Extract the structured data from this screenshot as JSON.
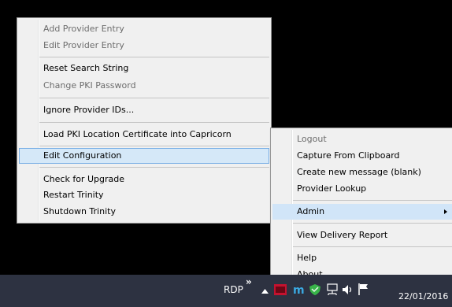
{
  "menu_left": {
    "items": [
      {
        "label": "Add Provider Entry",
        "disabled": true
      },
      {
        "label": "Edit Provider Entry",
        "disabled": true
      },
      {
        "label": "Reset Search String",
        "disabled": false
      },
      {
        "label": "Change PKI Password",
        "disabled": true
      },
      {
        "label": "Ignore Provider IDs...",
        "disabled": false
      },
      {
        "label": "Load PKI Location Certificate into Capricorn",
        "disabled": false
      },
      {
        "label": "Edit Configuration",
        "disabled": false,
        "highlighted": true
      },
      {
        "label": "Check for Upgrade",
        "disabled": false
      },
      {
        "label": "Restart Trinity",
        "disabled": false
      },
      {
        "label": "Shutdown Trinity",
        "disabled": false
      }
    ]
  },
  "menu_right": {
    "items": [
      {
        "label": "Logout",
        "disabled": true
      },
      {
        "label": "Capture From Clipboard",
        "disabled": false
      },
      {
        "label": "Create new message (blank)",
        "disabled": false
      },
      {
        "label": "Provider Lookup",
        "disabled": false
      },
      {
        "label": "Admin",
        "disabled": false,
        "has_submenu": true,
        "hovered": true
      },
      {
        "label": "View Delivery Report",
        "disabled": false
      },
      {
        "label": "Help",
        "disabled": false
      },
      {
        "label": "About...",
        "disabled": false
      }
    ]
  },
  "taskbar": {
    "toolbar_label": "RDP",
    "overflow_chevron": "»",
    "date": "22/01/2016",
    "colors": {
      "background": "#2d3241",
      "menu_background": "#f0f0f0",
      "highlight": "#d5e8f8",
      "highlight_border": "#78aee5"
    }
  },
  "tray_icons": [
    "show-hidden-icons-arrow-icon",
    "hl7-icon",
    "m-app-icon",
    "green-shield-icon",
    "network-icon",
    "speaker-icon",
    "action-center-flag-icon"
  ]
}
